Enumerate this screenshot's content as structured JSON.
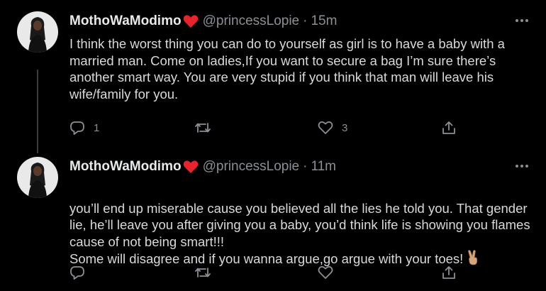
{
  "tweets": [
    {
      "display_name": "MothoWaModimo",
      "name_emoji": "red-heart",
      "handle": "@princessLopie",
      "separator": "·",
      "time": "15m",
      "text": "I think the worst thing you can do to yourself as girl is to have a baby with a married man. Come on ladies,If you want to secure a bag I’m sure there’s another smart way. You are very stupid if you think that man will leave his wife/family for you.",
      "reply_count": "1",
      "retweet_count": "",
      "like_count": "3"
    },
    {
      "display_name": "MothoWaModimo",
      "name_emoji": "red-heart",
      "handle": "@princessLopie",
      "separator": "·",
      "time": "11m",
      "text": "you’ll end up miserable cause you believed all the lies he told you. That gender lie, he’ll leave you after giving you a baby, you’d think life is showing you flames cause of not being smart!!!\nSome will disagree and if you wanna argue,go argue with your toes!",
      "trailing_emoji": "victory-hand",
      "reply_count": "",
      "retweet_count": "",
      "like_count": ""
    }
  ],
  "icons": {
    "reply": "reply-icon",
    "retweet": "retweet-icon",
    "like": "like-icon",
    "share": "share-icon",
    "more": "more-icon"
  },
  "colors": {
    "background": "#000000",
    "text": "#d9d9d9",
    "muted": "#8b8f94",
    "heart": "#e8232b",
    "thread_line": "#3a3d40"
  }
}
